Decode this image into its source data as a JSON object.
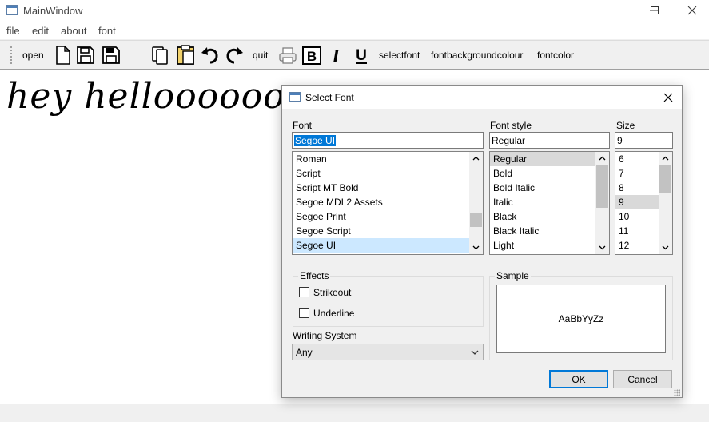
{
  "window": {
    "title": "MainWindow",
    "icon": "window-icon",
    "controls": [
      "minimize-icon",
      "maximize-icon",
      "close-icon"
    ]
  },
  "menu": {
    "items": [
      "file",
      "edit",
      "about",
      "font"
    ]
  },
  "toolbar": {
    "open_label": "open",
    "quit_label": "quit",
    "select_font_label": "selectfont",
    "font_bg_colour_label": "fontbackgroundcolour",
    "font_color_label": "fontcolor",
    "bold_glyph": "B",
    "italic_glyph": "I",
    "underline_glyph": "U",
    "icons": [
      "new-file-icon",
      "save-icon",
      "save-as-icon",
      "copy-icon",
      "paste-icon",
      "undo-icon",
      "redo-icon",
      "print-icon",
      "bold-icon",
      "italic-icon",
      "underline-icon"
    ]
  },
  "editor": {
    "text": "hey helloooooo"
  },
  "dialog": {
    "title": "Select Font",
    "font": {
      "label": "Font",
      "value": "Segoe UI",
      "items": [
        "Roman",
        "Script",
        "Script MT Bold",
        "Segoe MDL2 Assets",
        "Segoe Print",
        "Segoe Script",
        "Segoe UI"
      ],
      "selected": "Segoe UI"
    },
    "style": {
      "label": "Font style",
      "value": "Regular",
      "items": [
        "Regular",
        "Bold",
        "Bold Italic",
        "Italic",
        "Black",
        "Black Italic",
        "Light"
      ],
      "selected": "Regular"
    },
    "size": {
      "label": "Size",
      "value": "9",
      "items": [
        "6",
        "7",
        "8",
        "9",
        "10",
        "11",
        "12"
      ],
      "selected": "9"
    },
    "effects": {
      "label": "Effects",
      "strikeout_label": "Strikeout",
      "strikeout_checked": false,
      "underline_label": "Underline",
      "underline_checked": false
    },
    "sample": {
      "label": "Sample",
      "text": "AaBbYyZz"
    },
    "writing_system": {
      "label": "Writing System",
      "value": "Any"
    },
    "ok_label": "OK",
    "cancel_label": "Cancel"
  },
  "colors": {
    "selection_blue": "#0078d7",
    "list_selection": "#cce8ff",
    "list_current": "#d9d9d9",
    "window_bg": "#f0f0f0"
  }
}
